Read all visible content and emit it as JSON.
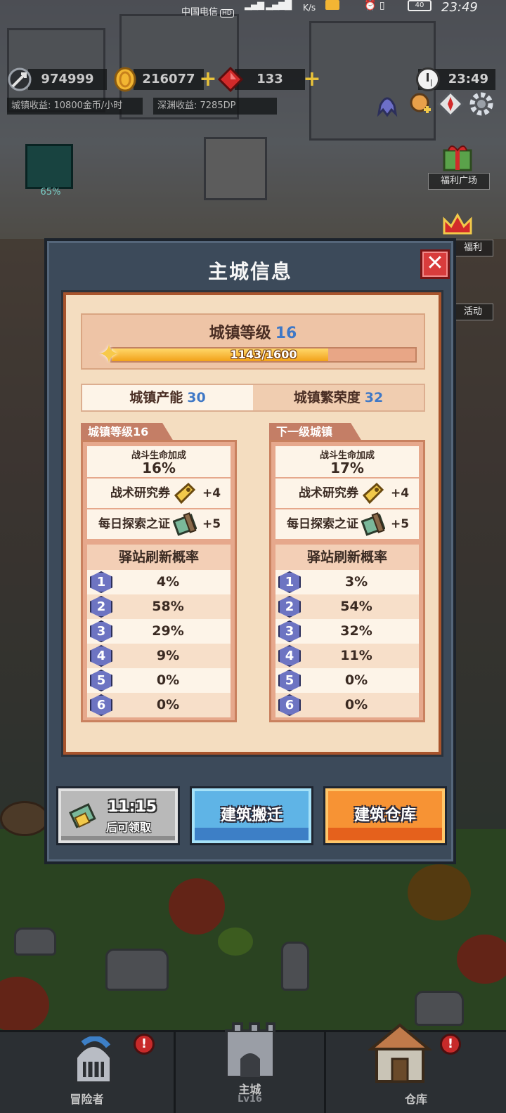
{
  "status_bar": {
    "carrier": "中国电信",
    "hd": "HD",
    "speed": "K/s",
    "battery": "40",
    "time": "23:49"
  },
  "hud": {
    "resources": [
      {
        "icon": "sword-icon",
        "value": "974999"
      },
      {
        "icon": "gold-coin-icon",
        "value": "216077"
      },
      {
        "icon": "red-gem-icon",
        "value": "133"
      }
    ],
    "town_income": "城镇收益: 10800金币/小时",
    "abyss_income": "深渊收益: 7285DP",
    "clock": "23:49",
    "side": {
      "progress_pct": "65%",
      "welfare_plaza": "福利广场",
      "welfare": "福利",
      "activity": "活动"
    }
  },
  "modal": {
    "title": "主城信息",
    "close": "✕",
    "town_level_label": "城镇等级",
    "town_level_value": "16",
    "xp_text": "1143/1600",
    "xp_fraction": 0.714,
    "capacity_label": "城镇产能",
    "capacity_value": "30",
    "prosperity_label": "城镇繁荣度",
    "prosperity_value": "32",
    "columns": [
      {
        "tab": "城镇等级16",
        "bonus_label": "战斗生命加成",
        "bonus_value": "16%",
        "research_label": "战术研究券",
        "research_count": "+4",
        "explore_label": "每日探索之证",
        "explore_count": "+5",
        "refresh_title": "驿站刷新概率",
        "tiers": [
          "4%",
          "58%",
          "29%",
          "9%",
          "0%",
          "0%"
        ]
      },
      {
        "tab": "下一级城镇",
        "bonus_label": "战斗生命加成",
        "bonus_value": "17%",
        "research_label": "战术研究券",
        "research_count": "+4",
        "explore_label": "每日探索之证",
        "explore_count": "+5",
        "refresh_title": "驿站刷新概率",
        "tiers": [
          "3%",
          "54%",
          "32%",
          "11%",
          "0%",
          "0%"
        ]
      }
    ],
    "tier_numbers": [
      "1",
      "2",
      "3",
      "4",
      "5",
      "6"
    ],
    "buttons": {
      "timer_time": "11:15",
      "timer_label": "后可领取",
      "relocate": "建筑搬迁",
      "warehouse": "建筑仓库"
    }
  },
  "nav": {
    "adventurer": "冒险者",
    "main_city": "主城",
    "main_city_level": "Lv16",
    "warehouse": "仓库",
    "badge": "!"
  }
}
